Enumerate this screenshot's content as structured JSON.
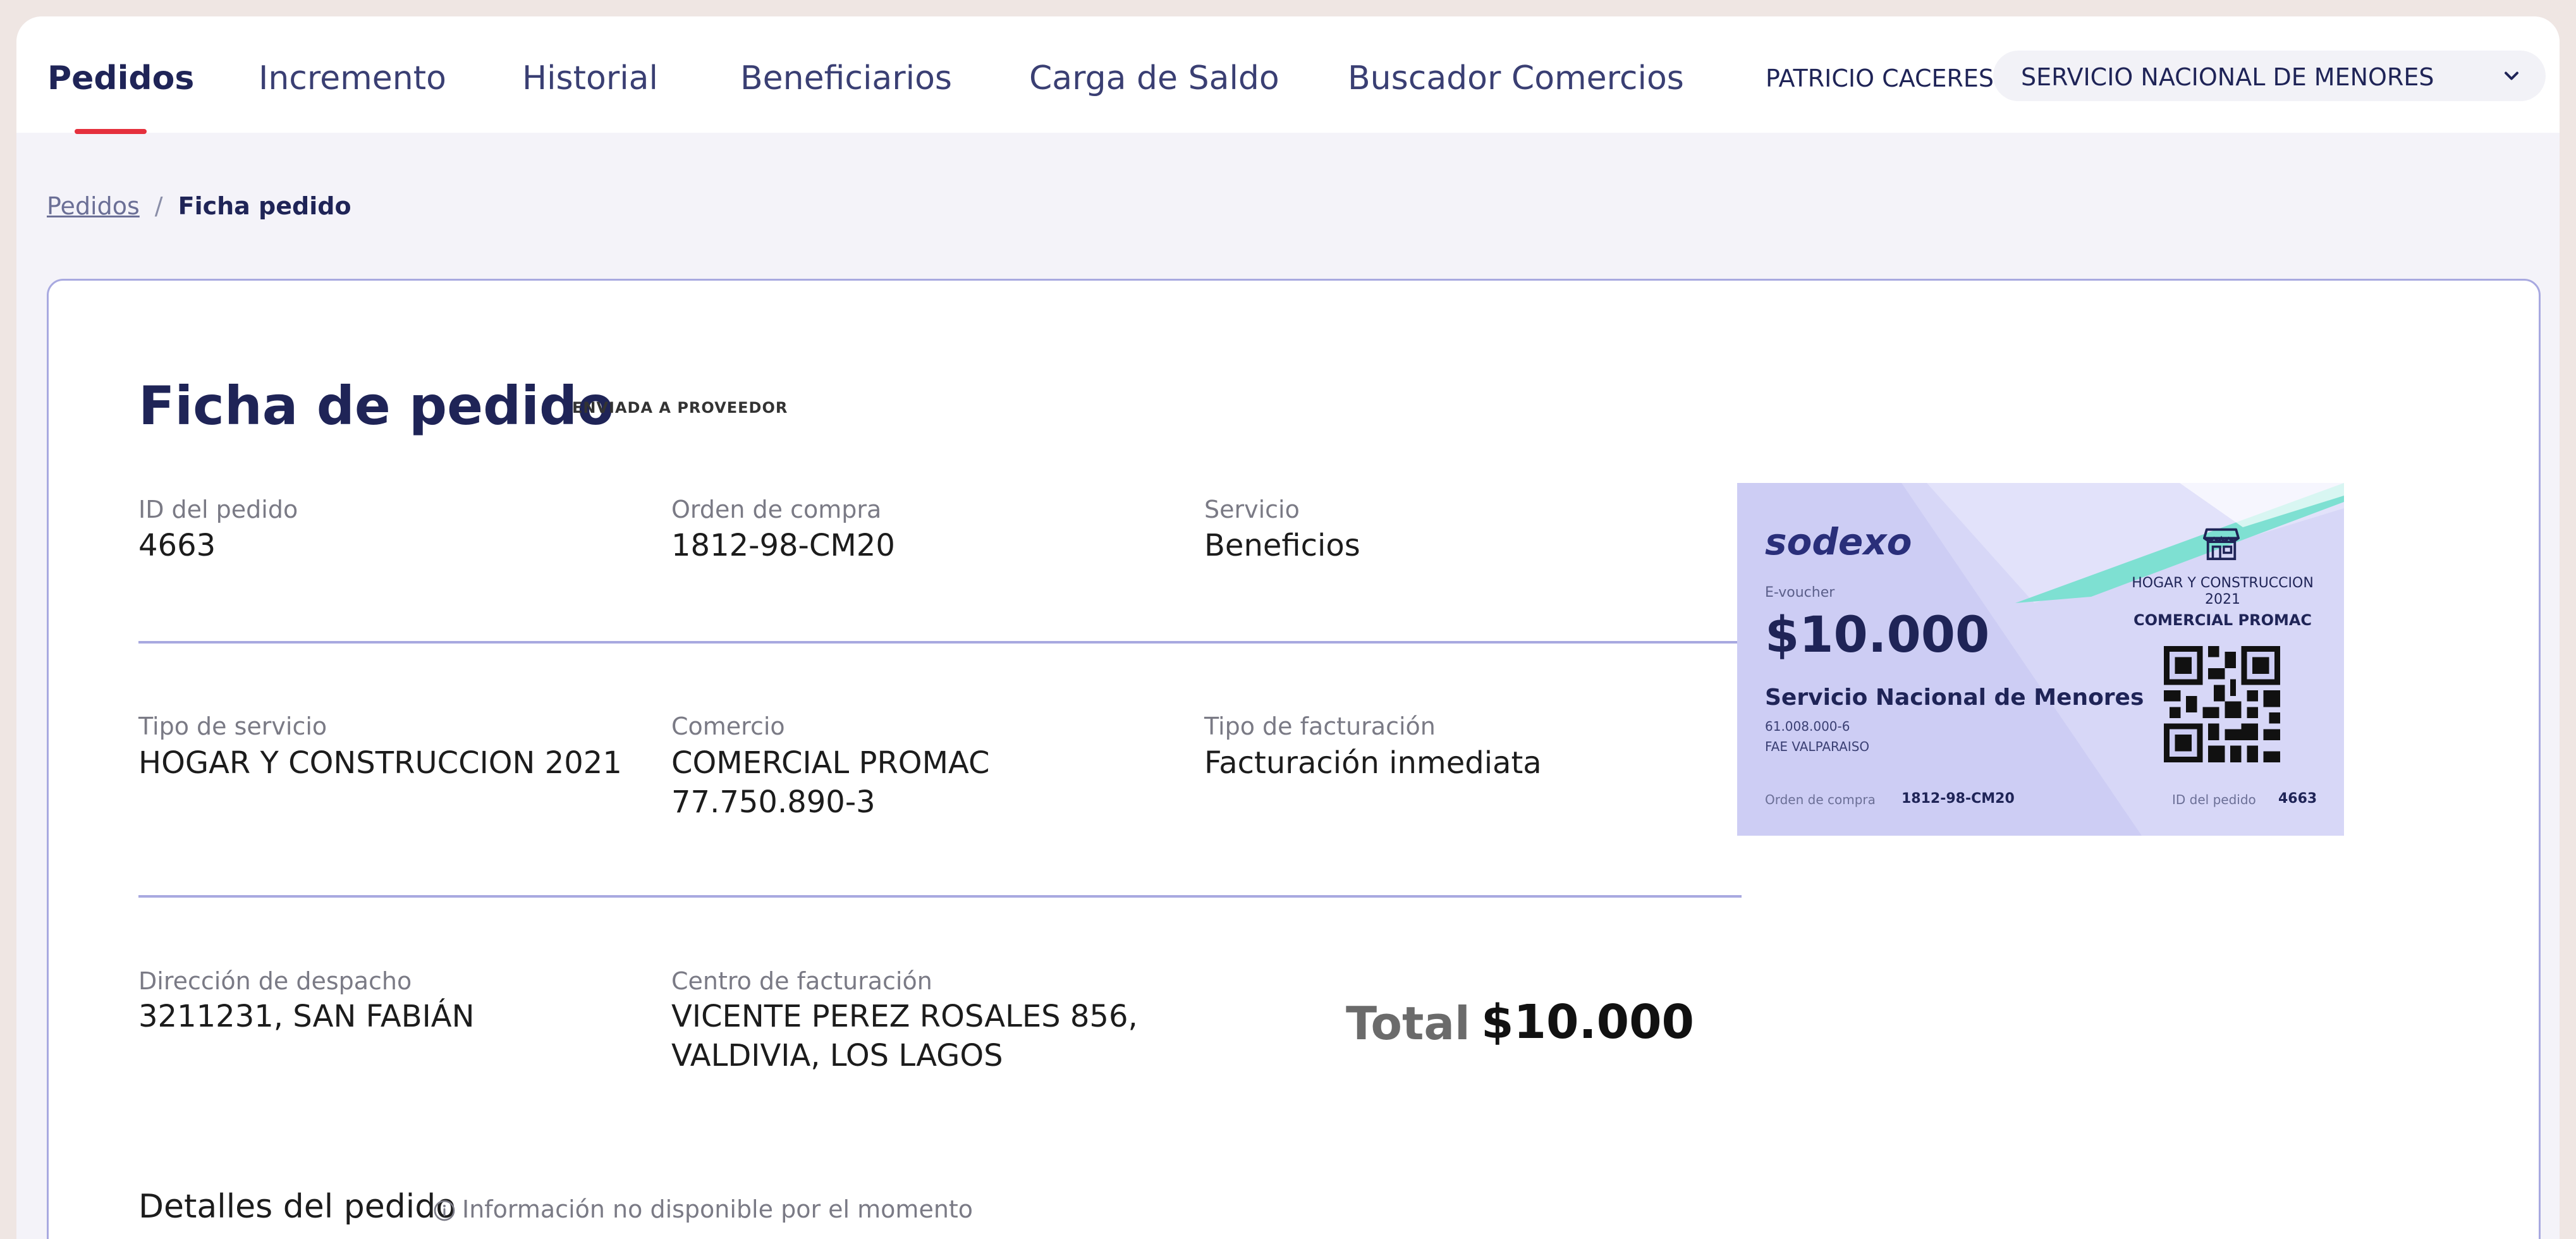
{
  "nav": {
    "tabs": [
      {
        "label": "Pedidos",
        "active": true
      },
      {
        "label": "Incremento"
      },
      {
        "label": "Historial"
      },
      {
        "label": "Beneficiarios"
      },
      {
        "label": "Carga de Saldo"
      },
      {
        "label": "Buscador Comercios"
      }
    ],
    "user_name": "PATRICIO CACERES",
    "org_select": {
      "value": "SERVICIO NACIONAL DE MENORES"
    }
  },
  "breadcrumb": {
    "parent": "Pedidos",
    "separator": "/",
    "current": "Ficha pedido"
  },
  "order": {
    "title": "Ficha de pedido",
    "status": "ENVIADA A PROVEEDOR",
    "fields": {
      "order_id": {
        "label": "ID del pedido",
        "value": "4663"
      },
      "purchase_order": {
        "label": "Orden de compra",
        "value": "1812-98-CM20"
      },
      "service": {
        "label": "Servicio",
        "value": "Beneficios"
      },
      "service_type": {
        "label": "Tipo de servicio",
        "value": "HOGAR Y CONSTRUCCION 2021"
      },
      "commerce": {
        "label": "Comercio",
        "value": "COMERCIAL PROMAC",
        "rut": "77.750.890-3"
      },
      "billing_type": {
        "label": "Tipo de facturación",
        "value": "Facturación inmediata"
      },
      "dispatch_address": {
        "label": "Dirección de despacho",
        "value": "3211231, SAN FABIÁN"
      },
      "billing_center": {
        "label": "Centro de facturación",
        "line1": "VICENTE PEREZ ROSALES 856,",
        "line2": "VALDIVIA, LOS LAGOS"
      }
    },
    "total": {
      "label": "Total",
      "value": "$10.000"
    },
    "details": {
      "title": "Detalles del pedido",
      "note": "Información no disponible por el momento"
    }
  },
  "voucher": {
    "brand": "sodexo",
    "type": "E-voucher",
    "amount": "$10.000",
    "client": "Servicio Nacional de Menores",
    "client_rut": "61.008.000-6",
    "branch": "FAE VALPARAISO",
    "service_type": "HOGAR Y CONSTRUCCION 2021",
    "commerce": "COMERCIAL PROMAC",
    "purchase_order_label": "Orden de compra",
    "purchase_order": "1812-98-CM20",
    "order_id_label": "ID del pedido",
    "order_id": "4663"
  },
  "colors": {
    "accent_underline": "#e5303d",
    "navy": "#1f2457",
    "card_border": "#a8a9e0",
    "voucher_bg": "#cdcdf4",
    "voucher_teal": "#7ee0d2"
  },
  "icons": [
    "chevron-down-icon",
    "info-icon",
    "store-icon",
    "qr-code-icon"
  ]
}
